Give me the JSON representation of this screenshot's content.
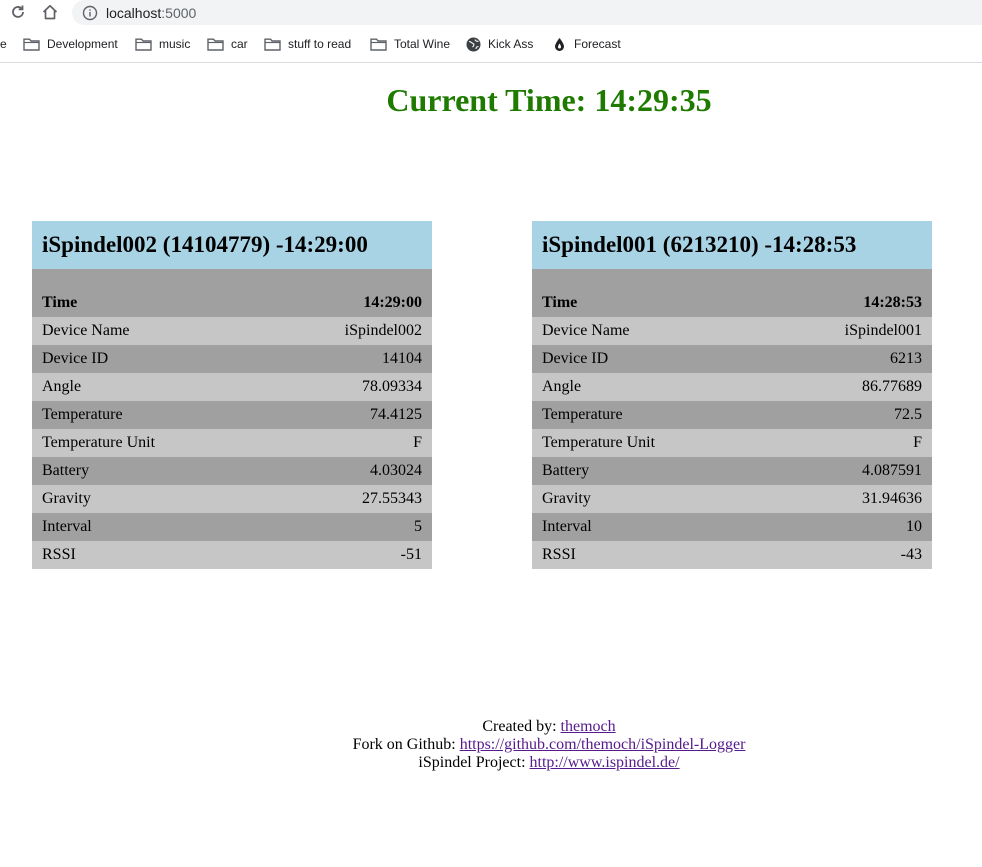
{
  "browser": {
    "url_host": "localhost",
    "url_port": ":5000",
    "bookmarks_partial_label": "e",
    "bookmarks": [
      {
        "label": "Development",
        "icon": "folder-icon"
      },
      {
        "label": "music",
        "icon": "folder-icon"
      },
      {
        "label": "car",
        "icon": "folder-icon"
      },
      {
        "label": "stuff to read",
        "icon": "folder-icon"
      },
      {
        "label": "Total Wine",
        "icon": "folder-icon"
      },
      {
        "label": "Kick Ass",
        "icon": "globe-icon"
      },
      {
        "label": "Forecast",
        "icon": "drop-icon"
      }
    ]
  },
  "page": {
    "current_time_label": "Current Time: 14:29:35",
    "title_color": "#1e7b00",
    "header_color": "#a7d3e4"
  },
  "devices": [
    {
      "title": "iSpindel002 (14104779) -14:29:00",
      "rows": [
        {
          "label": "Time",
          "value": "14:29:00"
        },
        {
          "label": "Device Name",
          "value": "iSpindel002"
        },
        {
          "label": "Device ID",
          "value": "14104"
        },
        {
          "label": "Angle",
          "value": "78.09334"
        },
        {
          "label": "Temperature",
          "value": "74.4125"
        },
        {
          "label": "Temperature Unit",
          "value": "F"
        },
        {
          "label": "Battery",
          "value": "4.03024"
        },
        {
          "label": "Gravity",
          "value": "27.55343"
        },
        {
          "label": "Interval",
          "value": "5"
        },
        {
          "label": "RSSI",
          "value": "-51"
        }
      ]
    },
    {
      "title": "iSpindel001 (6213210) -14:28:53",
      "rows": [
        {
          "label": "Time",
          "value": "14:28:53"
        },
        {
          "label": "Device Name",
          "value": "iSpindel001"
        },
        {
          "label": "Device ID",
          "value": "6213"
        },
        {
          "label": "Angle",
          "value": "86.77689"
        },
        {
          "label": "Temperature",
          "value": "72.5"
        },
        {
          "label": "Temperature Unit",
          "value": "F"
        },
        {
          "label": "Battery",
          "value": "4.087591"
        },
        {
          "label": "Gravity",
          "value": "31.94636"
        },
        {
          "label": "Interval",
          "value": "10"
        },
        {
          "label": "RSSI",
          "value": "-43"
        }
      ]
    }
  ],
  "footer": {
    "created_by_label": "Created by:",
    "created_by_link": "themoch",
    "github_label": "Fork on Github:",
    "github_link": "https://github.com/themoch/iSpindel-Logger",
    "project_label": "iSpindel Project:",
    "project_link": "http://www.ispindel.de/"
  }
}
